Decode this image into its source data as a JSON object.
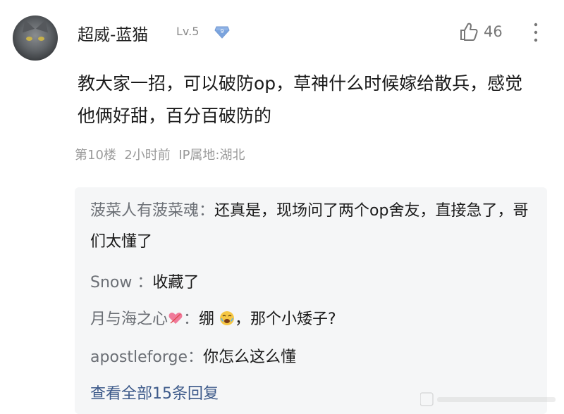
{
  "comment": {
    "username": "超威-蓝猫",
    "level": "Lv.5",
    "level_badge_number": "9",
    "likes": "46",
    "text": "教大家一招，可以破防op，草神什么时候嫁给散兵，感觉他俩好甜，百分百破防的",
    "floor": "第10楼",
    "time": "2小时前",
    "ip_location": "IP属地:湖北"
  },
  "replies": [
    {
      "name": "菠菜人有菠菜魂",
      "sep": "：",
      "text": "还真是，现场问了两个op舍友，直接急了，哥们太懂了"
    },
    {
      "name": "Snow ",
      "sep": "：",
      "text": "收藏了"
    },
    {
      "name": "月与海之心",
      "sep": "：",
      "text_before": "绷",
      "text_after": "，那个小矮子?"
    },
    {
      "name": "apostleforge",
      "sep": "：",
      "text": "你怎么这么懂"
    }
  ],
  "view_all_label": "查看全部15条回复",
  "colors": {
    "reply_name": "#6b6f75",
    "link": "#3d5a8a",
    "meta": "#9a9a9a",
    "reply_bg": "#f5f6f7"
  }
}
